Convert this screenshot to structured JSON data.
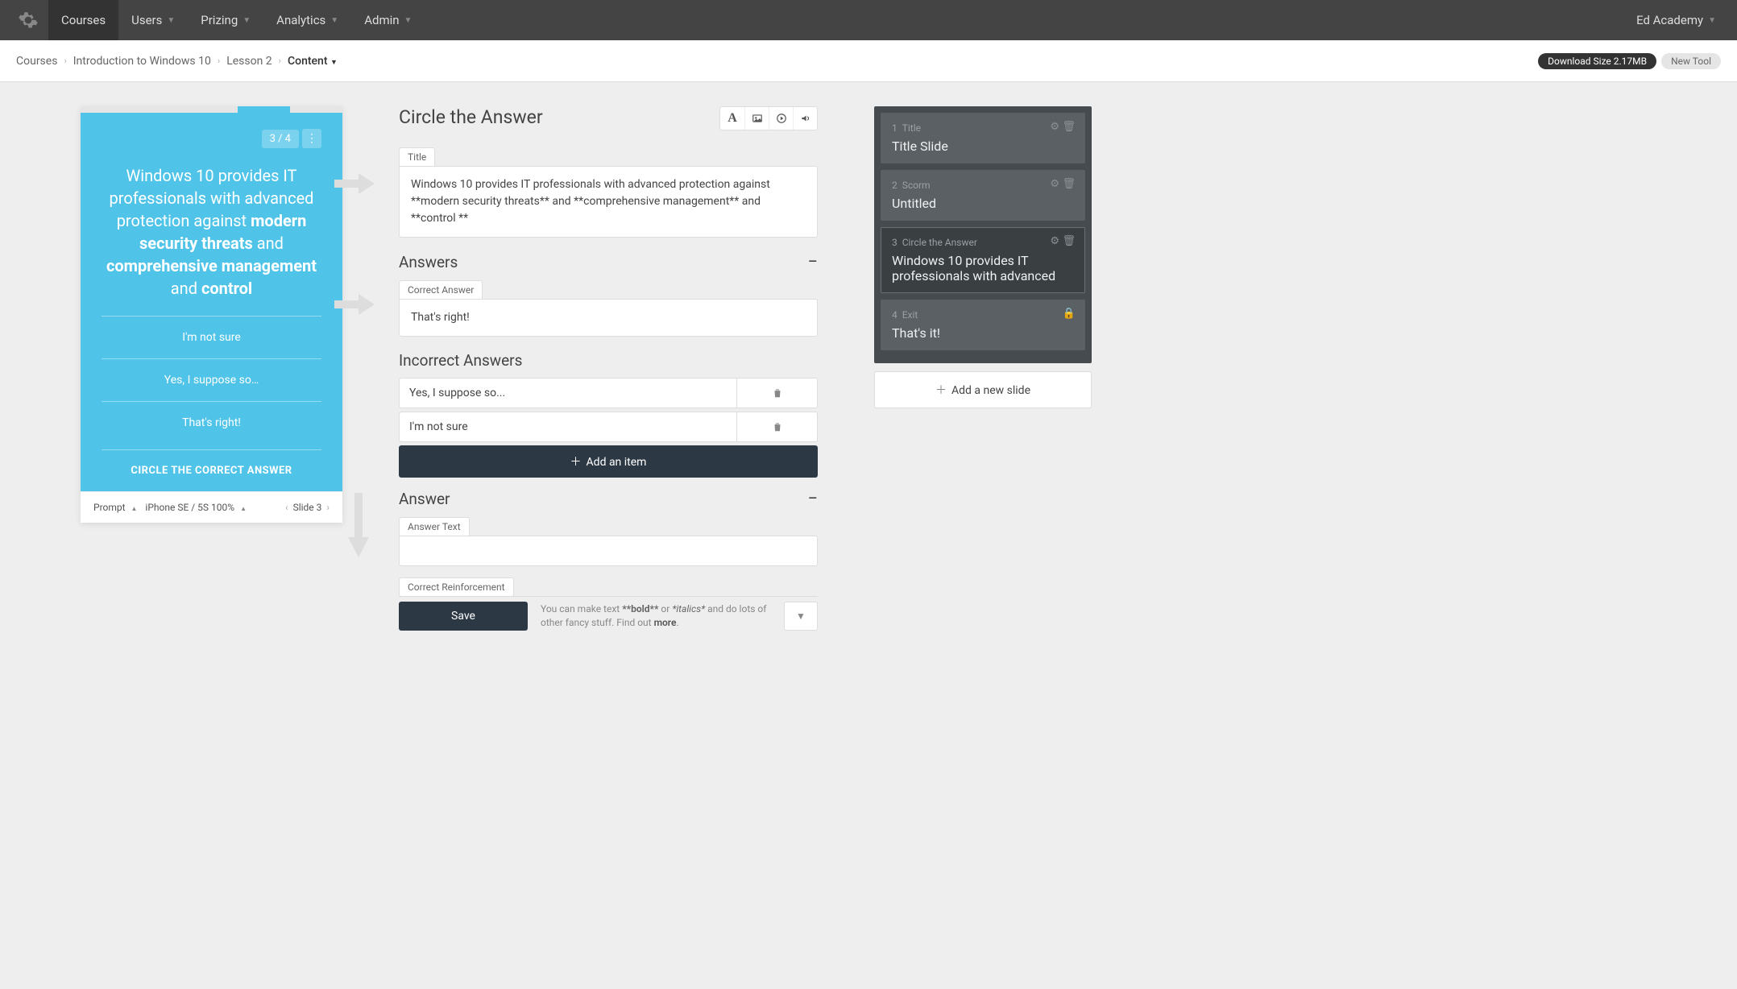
{
  "topnav": {
    "items": [
      "Courses",
      "Users",
      "Prizing",
      "Analytics",
      "Admin"
    ],
    "user": "Ed Academy"
  },
  "breadcrumb": {
    "items": [
      "Courses",
      "Introduction to Windows 10",
      "Lesson 2"
    ],
    "dropdown": "Content",
    "download": "Download Size 2.17MB",
    "newtool": "New Tool"
  },
  "preview": {
    "counter": "3 / 4",
    "statement_parts": {
      "p1": "Windows 10 provides IT professionals with advanced protection against ",
      "b1": "modern security threats",
      "p2": " and ",
      "b2": "comprehensive management",
      "p3": " and ",
      "b3": "control"
    },
    "options": [
      "I'm not sure",
      "Yes, I suppose so…",
      "That's right!"
    ],
    "footer": "CIRCLE THE CORRECT ANSWER",
    "bar": {
      "prompt": "Prompt",
      "device": "iPhone SE / 5S",
      "zoom": "100%",
      "slide": "Slide 3"
    }
  },
  "editor": {
    "heading": "Circle the Answer",
    "title_label": "Title",
    "title_value": "Windows 10 provides IT professionals with advanced protection against **modern security threats** and **comprehensive management** and **control **",
    "answers_heading": "Answers",
    "correct_label": "Correct Answer",
    "correct_value": "That's right!",
    "incorrect_heading": "Incorrect Answers",
    "incorrect": [
      "Yes, I suppose so...",
      "I'm not sure"
    ],
    "add_item": "Add an item",
    "answer_heading": "Answer",
    "answer_text_label": "Answer Text",
    "reinforcement_label": "Correct Reinforcement",
    "save": "Save",
    "hint": {
      "p1": "You can make text ",
      "bold": "**bold**",
      "or": " or ",
      "ital": "*italics*",
      "p2": " and do lots of other fancy stuff. Find out ",
      "more": "more"
    }
  },
  "slides": [
    {
      "num": "1",
      "type": "Title",
      "title": "Title Slide"
    },
    {
      "num": "2",
      "type": "Scorm",
      "title": "Untitled"
    },
    {
      "num": "3",
      "type": "Circle the Answer",
      "title": "Windows 10 provides IT professionals with advanced"
    },
    {
      "num": "4",
      "type": "Exit",
      "title": "That's it!"
    }
  ],
  "add_slide": "Add a new slide"
}
